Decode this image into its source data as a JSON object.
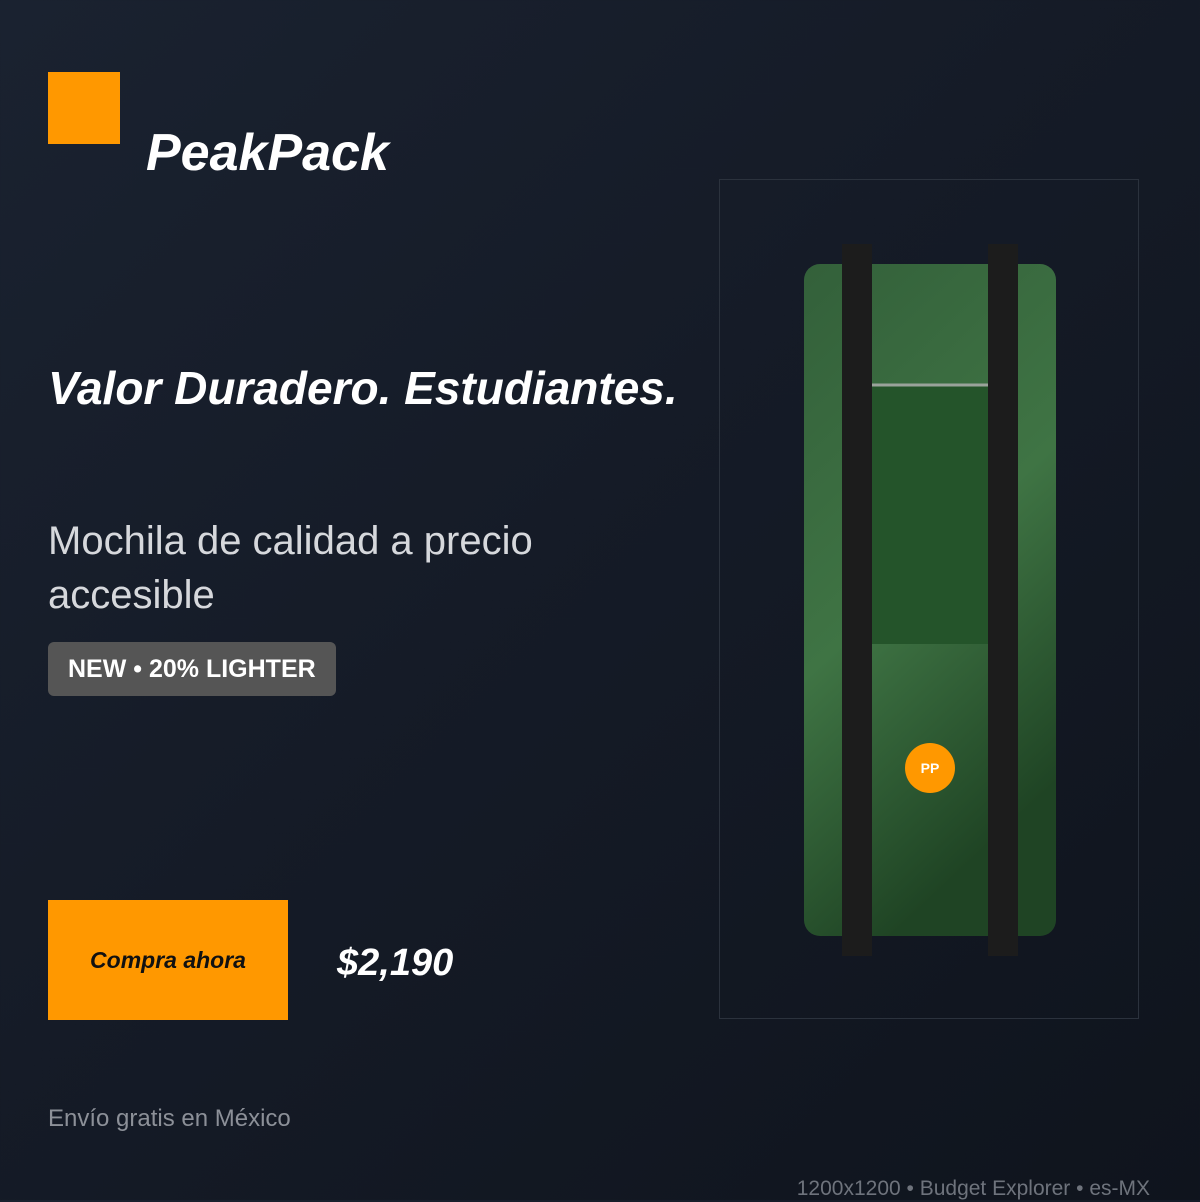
{
  "brand": {
    "name": "PeakPack",
    "logo_color": "#ff9800"
  },
  "hero": {
    "headline": "Valor Duradero. Estudiantes.",
    "subline": "Mochila de calidad a precio accesible",
    "badge": "NEW • 20% LIGHTER"
  },
  "cta": {
    "label": "Compra ahora",
    "color": "#ff9800"
  },
  "price": "$2,190",
  "shipping": "Envío gratis en México",
  "footer": "1200x1200 • Budget Explorer • es-MX",
  "product": {
    "emblem": "PP",
    "body_color": "#356a3c",
    "panel_color": "#24542a",
    "strap_color": "#1c1c1c",
    "emblem_color": "#ff9800"
  }
}
